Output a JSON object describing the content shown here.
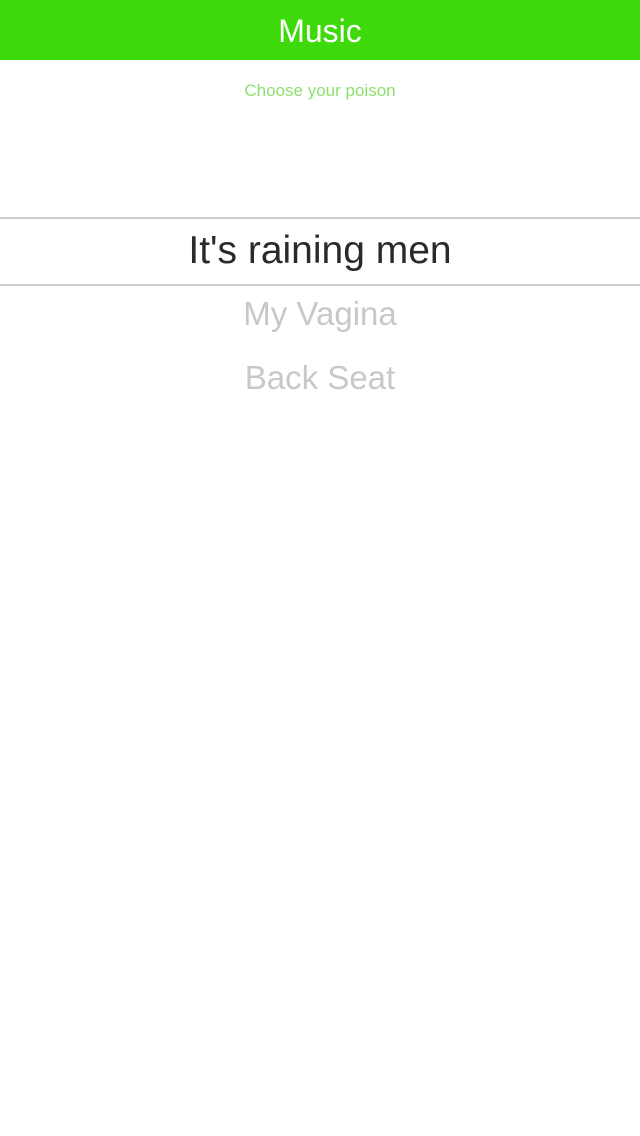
{
  "header": {
    "title": "Music",
    "background_color": "#3dd90a"
  },
  "subtitle": "Choose your poison",
  "picker": {
    "selected_index": 0,
    "options": [
      {
        "label": "It's raining men"
      },
      {
        "label": "My Vagina"
      },
      {
        "label": "Back Seat"
      }
    ]
  },
  "colors": {
    "selected_text": "#2a2a2a",
    "unselected_text": "#c8c8c8",
    "subtitle_text": "#8ee06e",
    "divider": "#cccccc"
  }
}
